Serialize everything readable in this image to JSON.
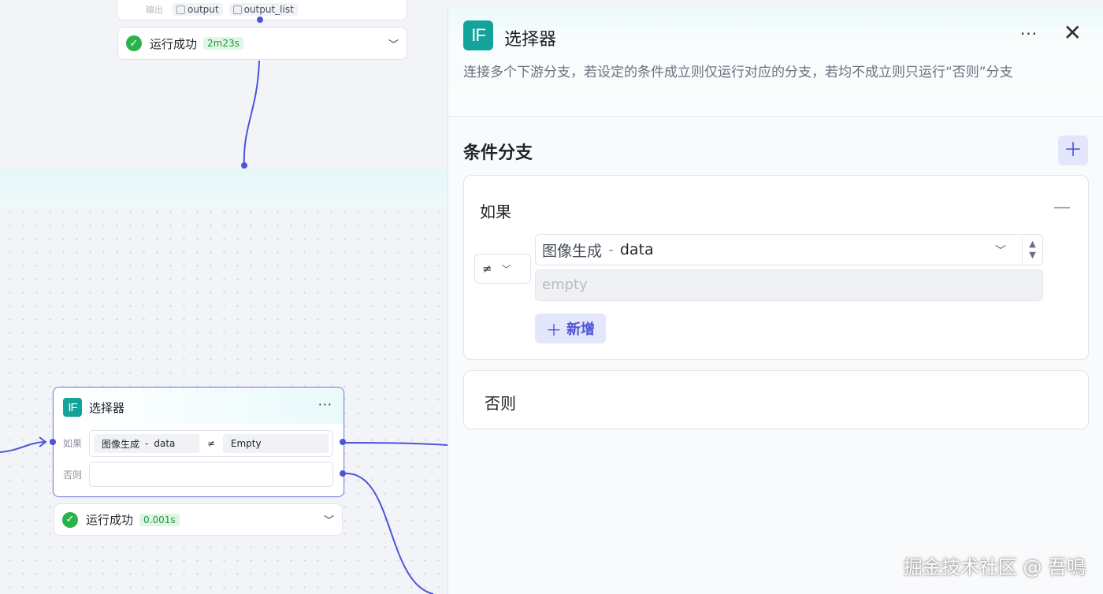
{
  "canvas": {
    "top_node": {
      "output_label": "输出",
      "outputs": [
        "output",
        "output_list"
      ]
    },
    "top_status": {
      "text": "运行成功",
      "time": "2m23s"
    },
    "selector_node": {
      "title": "选择器",
      "icon_text": "IF",
      "if_label": "如果",
      "else_label": "否则",
      "cond_node": "图像生成",
      "cond_sep": "-",
      "cond_field": "data",
      "cond_op": "≠",
      "cond_value": "Empty"
    },
    "node_status": {
      "text": "运行成功",
      "time": "0.001s"
    }
  },
  "panel": {
    "icon_text": "IF",
    "title": "选择器",
    "description": "连接多个下游分支，若设定的条件成立则仅运行对应的分支，若均不成立则只运行“否则”分支",
    "section_title": "条件分支",
    "if_card": {
      "label": "如果",
      "operator": "≠",
      "variable_node": "图像生成",
      "variable_sep": "-",
      "variable_field": "data",
      "value_placeholder": "empty",
      "add_label": "新增"
    },
    "else_card": {
      "label": "否则"
    }
  },
  "watermark": "掘金技术社区 @ 吾鳴",
  "colors": {
    "accent": "#4d54d9",
    "if_icon": "#14a39a",
    "success": "#2bb24c"
  }
}
